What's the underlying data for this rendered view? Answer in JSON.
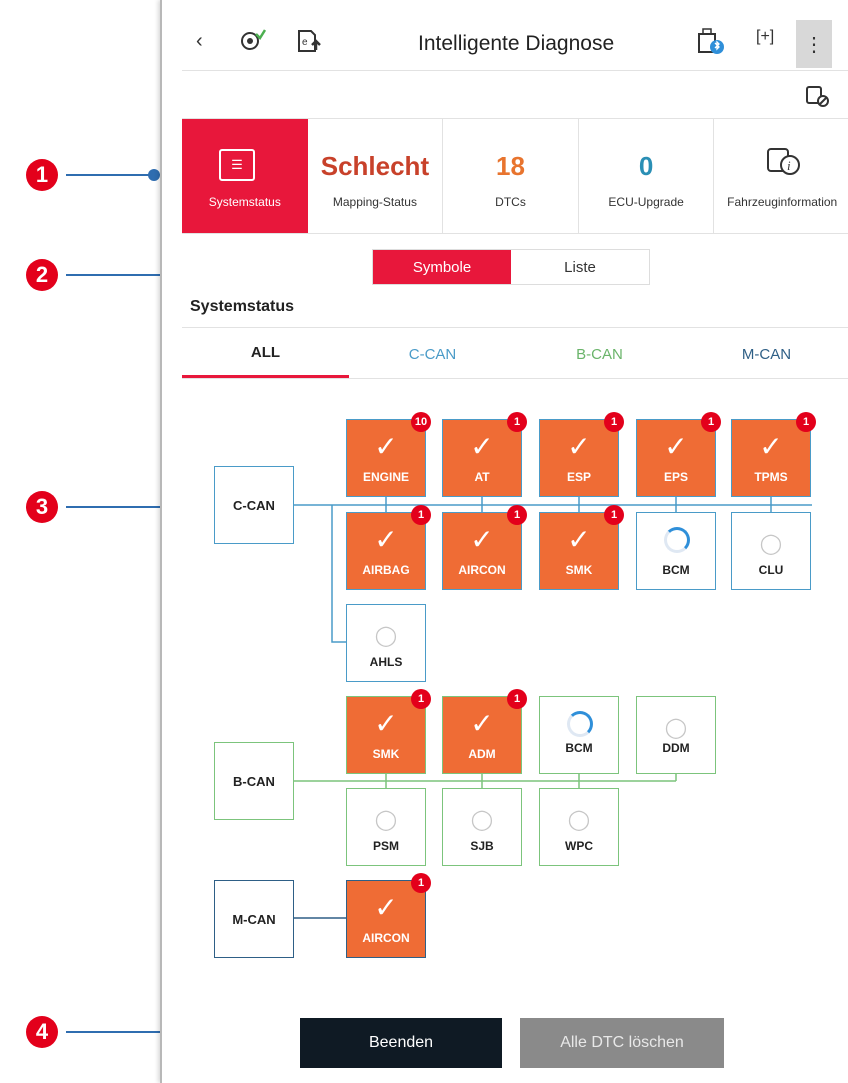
{
  "callouts": [
    "1",
    "2",
    "3",
    "4"
  ],
  "header": {
    "title": "Intelligente Diagnose",
    "icons": [
      "back-icon",
      "diagnosis-icon",
      "export-icon",
      "bluetooth-vci-icon",
      "screenshot-icon",
      "more-menu-icon"
    ]
  },
  "summary": [
    {
      "big": "",
      "label": "Systemstatus"
    },
    {
      "big": "Schlecht",
      "label": "Mapping-Status",
      "color": "#c8412a"
    },
    {
      "big": "18",
      "label": "DTCs",
      "color": "#e8742e"
    },
    {
      "big": "0",
      "label": "ECU-Upgrade",
      "color": "#2a8fb5"
    },
    {
      "big": "",
      "label": "Fahrzeuginformation"
    }
  ],
  "view_toggle": {
    "symbols": "Symbole",
    "list": "Liste"
  },
  "section_title": "Systemstatus",
  "tabs": [
    {
      "label": "ALL",
      "color": "#222222"
    },
    {
      "label": "C-CAN",
      "color": "#4a9bc8"
    },
    {
      "label": "B-CAN",
      "color": "#6ab46a"
    },
    {
      "label": "M-CAN",
      "color": "#2e5f86"
    }
  ],
  "buses": {
    "ccan": "C-CAN",
    "bcan": "B-CAN",
    "mcan": "M-CAN"
  },
  "nodes": {
    "engine": {
      "name": "ENGINE",
      "badge": "10"
    },
    "at": {
      "name": "AT",
      "badge": "1"
    },
    "esp": {
      "name": "ESP",
      "badge": "1"
    },
    "eps": {
      "name": "EPS",
      "badge": "1"
    },
    "tpms": {
      "name": "TPMS",
      "badge": "1"
    },
    "airbag": {
      "name": "AIRBAG",
      "badge": "1"
    },
    "aircon": {
      "name": "AIRCON",
      "badge": "1"
    },
    "smk": {
      "name": "SMK",
      "badge": "1"
    },
    "bcm": {
      "name": "BCM"
    },
    "clu": {
      "name": "CLU"
    },
    "ahls": {
      "name": "AHLS"
    },
    "b_smk": {
      "name": "SMK",
      "badge": "1"
    },
    "b_adm": {
      "name": "ADM",
      "badge": "1"
    },
    "b_bcm": {
      "name": "BCM"
    },
    "b_ddm": {
      "name": "DDM"
    },
    "b_psm": {
      "name": "PSM"
    },
    "b_sjb": {
      "name": "SJB"
    },
    "b_wpc": {
      "name": "WPC"
    },
    "m_aircon": {
      "name": "AIRCON",
      "badge": "1"
    }
  },
  "buttons": {
    "exit": "Beenden",
    "clear": "Alle DTC löschen"
  },
  "colors": {
    "accent": "#e8173b",
    "error": "#ef6c35",
    "ccan": "#4a9bc8",
    "bcan": "#7cc47c",
    "mcan": "#2e5f86"
  }
}
